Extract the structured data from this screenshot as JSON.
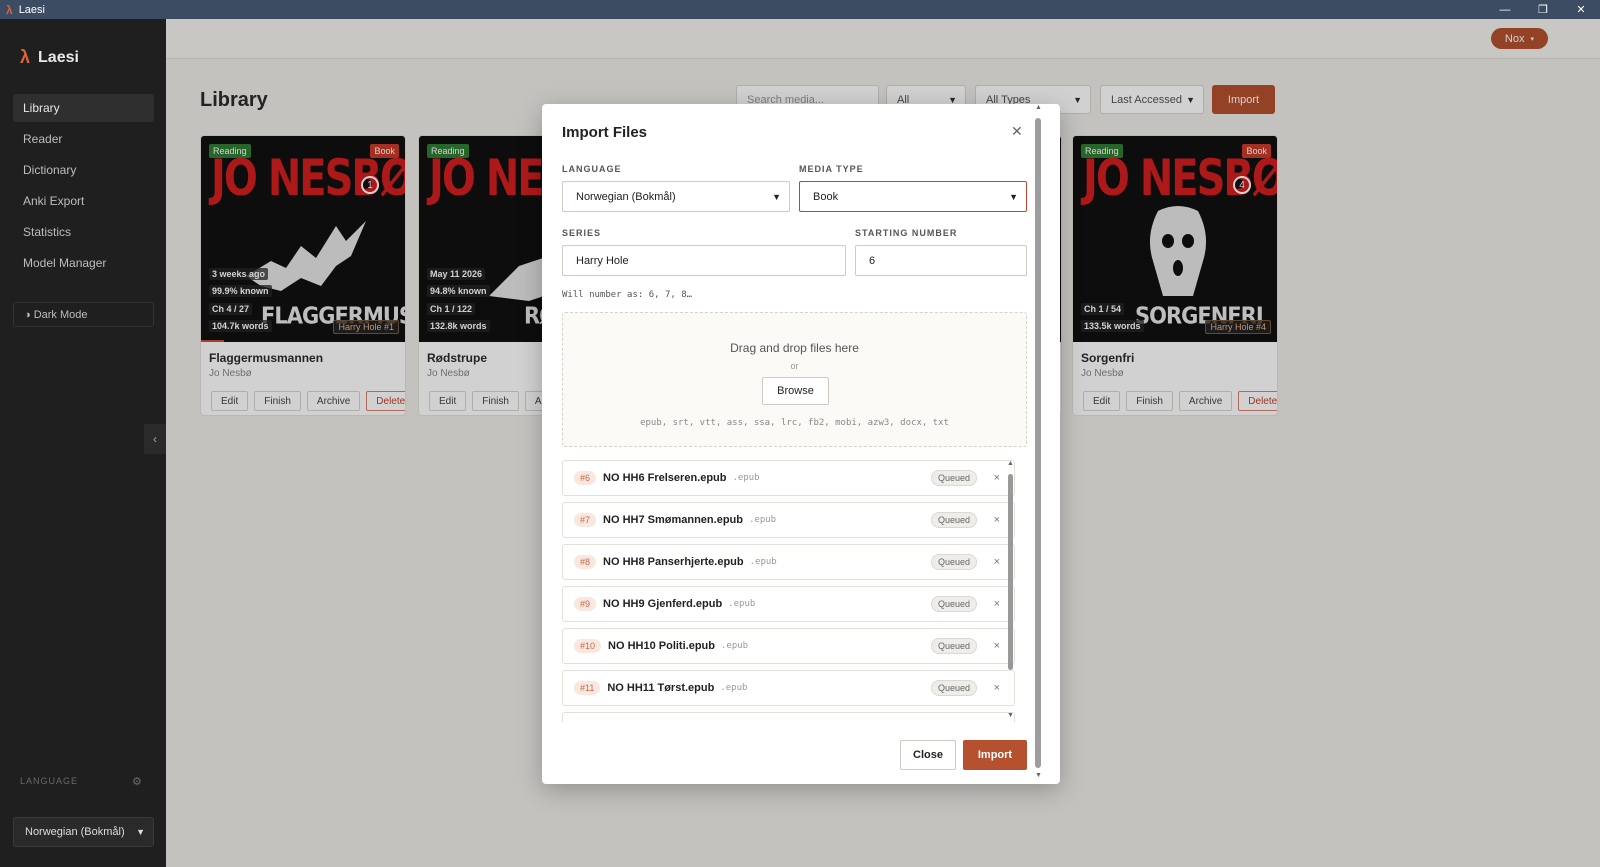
{
  "window": {
    "title": "Laesi",
    "minimize": "—",
    "maximize": "❐",
    "close": "✕"
  },
  "sidebar": {
    "brand": "Laesi",
    "brand_icon": "λ",
    "items": [
      {
        "label": "Library"
      },
      {
        "label": "Reader"
      },
      {
        "label": "Dictionary"
      },
      {
        "label": "Anki Export"
      },
      {
        "label": "Statistics"
      },
      {
        "label": "Model Manager"
      }
    ],
    "dark_mode": "◑ Dark Mode",
    "collapse": "‹",
    "language_label": "LANGUAGE",
    "language_value": "Norwegian (Bokmål)"
  },
  "topbar": {
    "user": "Nox",
    "user_chevron": "▾"
  },
  "library": {
    "title": "Library",
    "search_placeholder": "Search media...",
    "filter_all": "All",
    "filter_types": "All Types",
    "sort": "Last Accessed",
    "import_label": "Import",
    "cards": [
      {
        "status": "Reading",
        "type": "Book",
        "cover_title": "JO NESBØ",
        "series_no": "1",
        "accessed": "3 weeks ago",
        "known": "99.9% known",
        "chapter": "Ch 4 / 27",
        "words": "104.7k words",
        "cover_big": "FLAGGERMUSMANNEN",
        "series_tag": "Harry Hole #1",
        "title": "Flaggermusmannen",
        "author": "Jo Nesbø",
        "progress": 0.11
      },
      {
        "status": "Reading",
        "type": "Book",
        "cover_title": "JO NESBØ",
        "series_no": "",
        "accessed": "May 11 2026",
        "known": "94.8% known",
        "chapter": "Ch 1 / 122",
        "words": "132.8k words",
        "cover_big": "RØDSTRUPE",
        "series_tag": "",
        "title": "Rødstrupe",
        "author": "Jo Nesbø",
        "progress": 0
      },
      {
        "status": "Reading",
        "type": "Book",
        "cover_title": "JO NESBØ",
        "series_no": "4",
        "accessed": "",
        "known": "",
        "chapter": "Ch 1 / 54",
        "words": "133.5k words",
        "cover_big": "SORGENFRI",
        "series_tag": "Harry Hole #4",
        "title": "Sorgenfri",
        "author": "Jo Nesbø",
        "progress": 0
      }
    ],
    "card_buttons": {
      "edit": "Edit",
      "finish": "Finish",
      "archive": "Archive",
      "delete": "Delete"
    }
  },
  "modal": {
    "title": "Import Files",
    "close_icon": "✕",
    "language_label": "LANGUAGE",
    "language_value": "Norwegian (Bokmål)",
    "media_type_label": "MEDIA TYPE",
    "media_type_value": "Book",
    "series_label": "SERIES",
    "series_value": "Harry Hole",
    "starting_number_label": "STARTING NUMBER",
    "starting_number_value": "6",
    "number_hint": "Will number as: 6, 7, 8…",
    "dropzone_text": "Drag and drop files here",
    "dropzone_or": "or",
    "browse_label": "Browse",
    "extensions": "epub, srt, vtt, ass, ssa, lrc, fb2, mobi, azw3, docx, txt",
    "files": [
      {
        "num": "#6",
        "name": "NO HH6 Frelseren.epub",
        "ext": ".epub",
        "status": "Queued"
      },
      {
        "num": "#7",
        "name": "NO HH7 Smømannen.epub",
        "ext": ".epub",
        "status": "Queued"
      },
      {
        "num": "#8",
        "name": "NO HH8 Panserhjerte.epub",
        "ext": ".epub",
        "status": "Queued"
      },
      {
        "num": "#9",
        "name": "NO HH9 Gjenferd.epub",
        "ext": ".epub",
        "status": "Queued"
      },
      {
        "num": "#10",
        "name": "NO HH10 Politi.epub",
        "ext": ".epub",
        "status": "Queued"
      },
      {
        "num": "#11",
        "name": "NO HH11 Tørst.epub",
        "ext": ".epub",
        "status": "Queued"
      }
    ],
    "remove_icon": "×",
    "close_label": "Close",
    "import_label": "Import"
  },
  "colors": {
    "accent": "#b5512f",
    "sidebar": "#1f1f1f",
    "reading": "#2f7d32",
    "book": "#c83b2a"
  }
}
